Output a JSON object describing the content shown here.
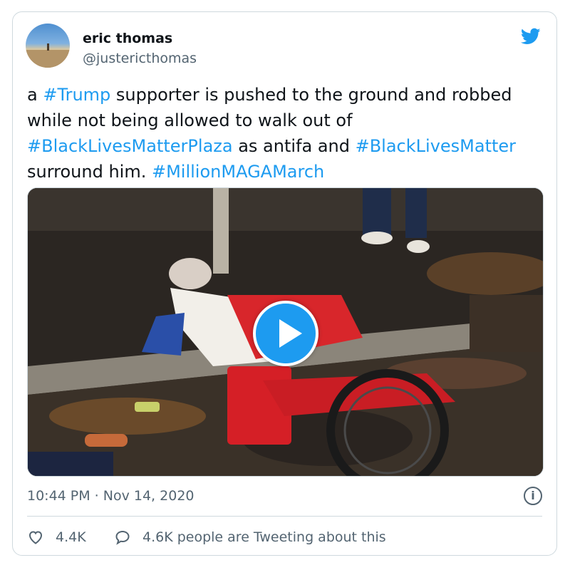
{
  "author": {
    "name": "eric thomas",
    "handle": "@justericthomas"
  },
  "tweet": {
    "segments": [
      {
        "text": "a ",
        "tag": false
      },
      {
        "text": "#Trump",
        "tag": true
      },
      {
        "text": " supporter is pushed to the ground and robbed while not being allowed to walk out of ",
        "tag": false
      },
      {
        "text": "#BlackLivesMatterPlaza",
        "tag": true
      },
      {
        "text": " as antifa and ",
        "tag": false
      },
      {
        "text": "#BlackLivesMatter",
        "tag": true
      },
      {
        "text": " surround him. ",
        "tag": false
      },
      {
        "text": "#MillionMAGAMarch",
        "tag": true
      }
    ]
  },
  "media": {
    "type": "video",
    "play_icon": "play-icon"
  },
  "meta": {
    "timestamp": "10:44 PM · Nov 14, 2020",
    "info_icon": "i"
  },
  "actions": {
    "like_count": "4.4K",
    "reply_text": "4.6K people are Tweeting about this"
  },
  "colors": {
    "accent": "#1d9bf0",
    "secondary_text": "#536471",
    "border": "#cfd9de"
  }
}
